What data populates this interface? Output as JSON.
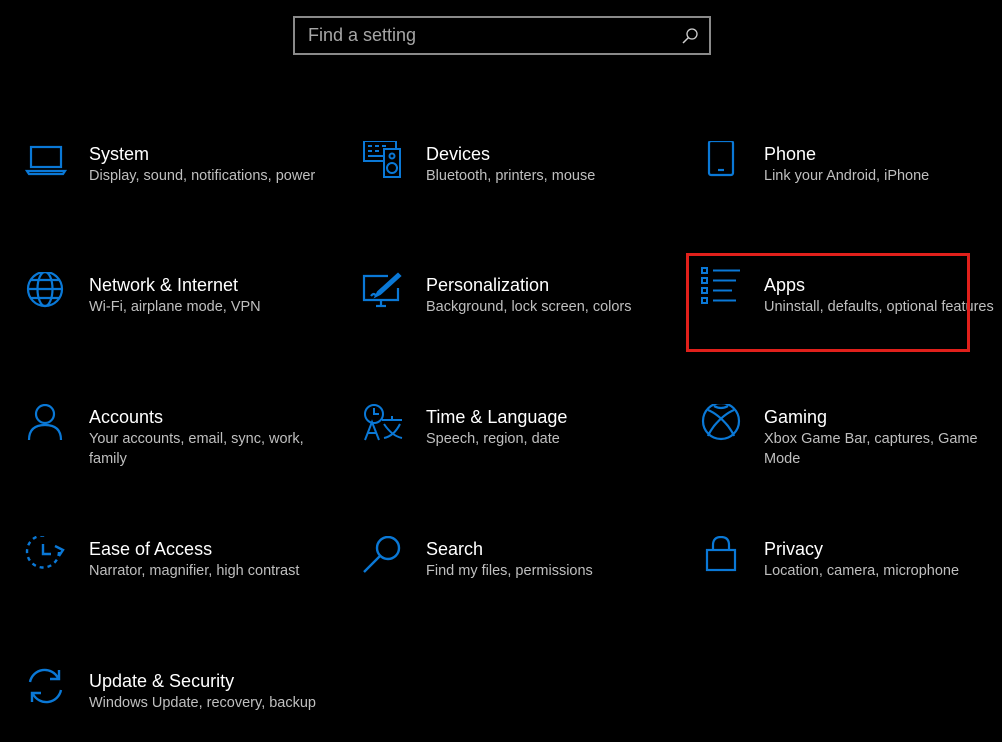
{
  "search": {
    "placeholder": "Find a setting",
    "value": ""
  },
  "accent_color": "#0a78d6",
  "highlight_color": "#e0201b",
  "tiles": [
    {
      "title": "System",
      "desc": "Display, sound, notifications, power",
      "icon": "laptop-icon"
    },
    {
      "title": "Devices",
      "desc": "Bluetooth, printers, mouse",
      "icon": "devices-icon"
    },
    {
      "title": "Phone",
      "desc": "Link your Android, iPhone",
      "icon": "phone-icon"
    },
    {
      "title": "Network & Internet",
      "desc": "Wi-Fi, airplane mode, VPN",
      "icon": "globe-icon"
    },
    {
      "title": "Personalization",
      "desc": "Background, lock screen, colors",
      "icon": "paint-icon"
    },
    {
      "title": "Apps",
      "desc": "Uninstall, defaults, optional features",
      "icon": "apps-list-icon"
    },
    {
      "title": "Accounts",
      "desc": "Your accounts, email, sync, work, family",
      "icon": "person-icon"
    },
    {
      "title": "Time & Language",
      "desc": "Speech, region, date",
      "icon": "time-language-icon"
    },
    {
      "title": "Gaming",
      "desc": "Xbox Game Bar, captures, Game Mode",
      "icon": "xbox-icon"
    },
    {
      "title": "Ease of Access",
      "desc": "Narrator, magnifier, high contrast",
      "icon": "ease-of-access-icon"
    },
    {
      "title": "Search",
      "desc": "Find my files, permissions",
      "icon": "magnifier-icon"
    },
    {
      "title": "Privacy",
      "desc": "Location, camera, microphone",
      "icon": "lock-icon"
    },
    {
      "title": "Update & Security",
      "desc": "Windows Update, recovery, backup",
      "icon": "sync-icon"
    }
  ]
}
